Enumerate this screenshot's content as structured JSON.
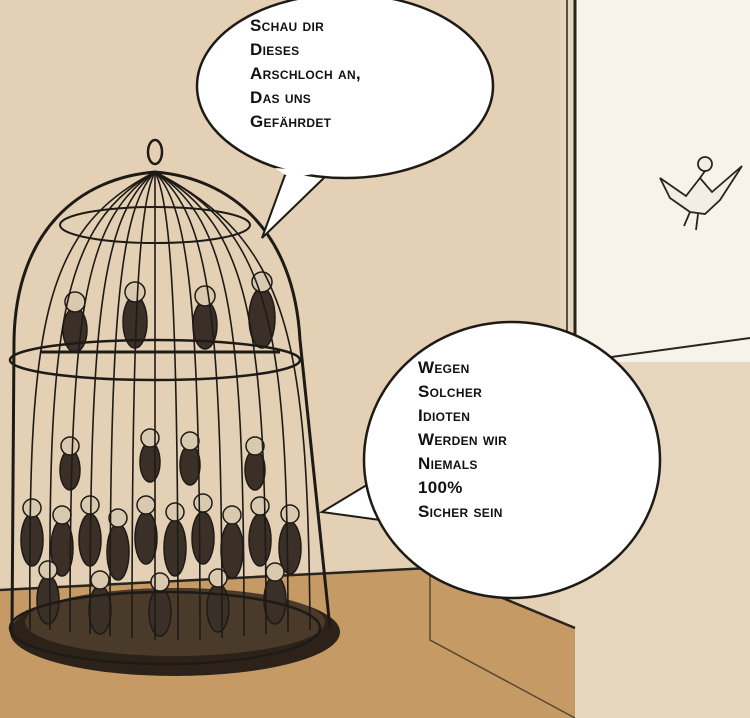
{
  "speech_bubble_top": {
    "lines": [
      "SCHAU DIR",
      "DIESES",
      "ARSCHLOCH AN,",
      "DAS UNS",
      "GEFÄHRDET"
    ]
  },
  "speech_bubble_right": {
    "lines": [
      "WEGEN",
      "SOLCHER",
      "IDIOTEN",
      "WERDEN WIR",
      "NIEMALS",
      "100%",
      "SICHER SEIN"
    ]
  },
  "colors": {
    "wall": "#e6d6bd",
    "window_light": "#f7f3ea",
    "table": "#c59a64",
    "ink": "#1e1a16",
    "bubble_fill": "#ffffff"
  }
}
